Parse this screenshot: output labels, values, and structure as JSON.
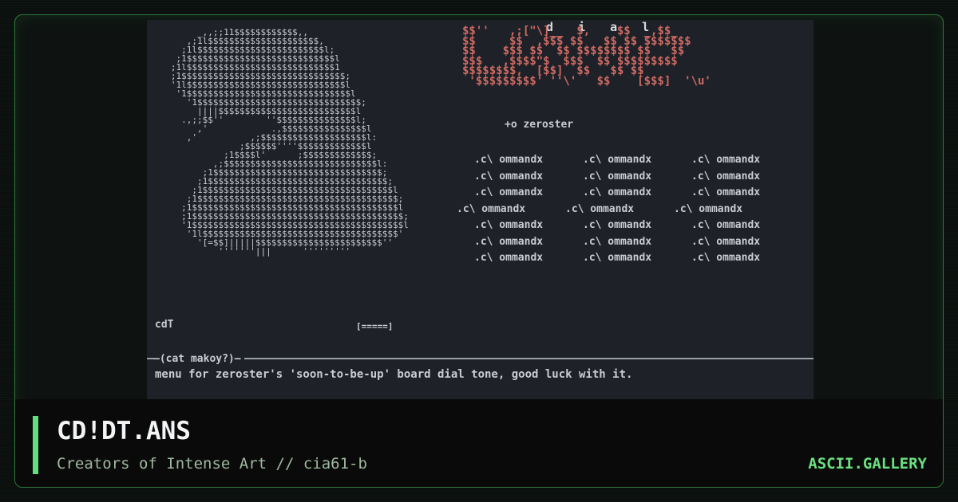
{
  "artwork": {
    "dial_letters": "d i a l",
    "logo_ascii": "$$''   ,;[\"\\]__  $,    $$  _,$$_\n$$     $$  ,$$$ $$   $$ $$ $$$$$$$\n$$    $$$ $$  $$ $$$$$$$$ $$   $$\n$$$   ,$$$$\"$  $$$  $$ $$$$$$$$$\n$$$$$$$$,  [$$]  $$   $$ $$\n '$$$$$$$$$' ''\\'   $$    [$$$]  '\\u'",
    "head_ascii": "        _,,;;11$$$$$$$$$$$$,,\n      ,;1l$$$$$$$$$$$$$$$$$$$$$,\n     ;1l$$$$$$$$$$$$$$$$$$$$$$$$l;\n    ;1$$$$$$$$$$$$$$$$$$$$$$$$$$$$l\n   ;1l$$$$$$$$$$$$$$$$$$$$$$$$$$$$1\n   ;1$$$$$$$$$$$$$$$$$$$$$$$$$$$$$$$;\n   '1l$$$$$$$$$$$$$$$$$$$$$$$$$$$$$$l\n    '1$$$$$$$$$$$$$$$$$$$$$$$$$$$$$$$l\n      '1$$$$$$$$$$$$$$$$$$$$$$$$$$$$$$$;\n        ||||$$$$$$$$$$$$$$$$$$$$$$$$$$l\n     .,;;$$''        ''$$$$$$$$$$$$$$$l;\n        ,'            .,$$$$$$$$$$$$$$$$l\n      ,'          ,;$$$$$$$$$$$$$$$$$$$$l:\n                ;$$$$$$''''$$$$$$$$$$$$$l\n             ;1$$$$l'      ;$$$$$$$$$$$$$;\n           ,;$$$$$$$$$$$$$$$$$$$$$$$$$$$$$l:\n         ;1$$$$$$$$$$$$$$$$$$$$$$$$$$$$$$$$;\n        ;1$$$$$$$$$$$$$$$$$$$$$$$$$$$$$$$$$$;\n       ;1$$$$$$$$$$$$$$$$$$$$$$$$$$$$$$$$$$$$l\n      ;1$$$$$$$$$$$$$$$$$$$$$$$$$$$$$$$$$$$$$$;\n     ;1$$$$$$$$$$$$$$$$$$$$$$$$$$$$$$$$$$$$$$$l\n     ;1$$$$$$$$$$$$$$$$$$$$$$$$$$$$$$$$$$$$$$$$;\n     '1$$$$$$$$$$$$$$$$$$$$$$$$$$$$$$$$$$$$$$$$l\n      '1l$$$$$$$$$$$$$$$$$$$$$$$$$$$$$$$$$$$$$'\n        '[=$$]|||||$$$$$$$$$$$$$$$$$$$$$$$$''\n            '''''''|||      '''''''''",
    "byline": "+o zeroster",
    "menu_rows": [
      [
        ".c\\ ommandx",
        ".c\\ ommandx",
        ".c\\ ommandx"
      ],
      [
        ".c\\ ommandx",
        ".c\\ ommandx",
        ".c\\ ommandx"
      ],
      [
        ".c\\ ommandx",
        ".c\\ ommandx",
        ".c\\ ommandx"
      ],
      [
        ".c\\ ommandx",
        ".c\\ ommandx",
        ".c\\ ommandx"
      ],
      [
        ".c\\ ommandx",
        ".c\\ ommandx",
        ".c\\ ommandx"
      ],
      [
        ".c\\ ommandx",
        ".c\\ ommandx",
        ".c\\ ommandx"
      ],
      [
        ".c\\ ommandx",
        ".c\\ ommandx",
        ".c\\ ommandx"
      ]
    ],
    "cdt_tag": "cdT",
    "sub_bar": "[=====]",
    "divider_label": "—(cat makoy?)—",
    "caption": "menu for zeroster's 'soon-to-be-up' board dial tone, good luck with it."
  },
  "footer": {
    "title": "CD!DT.ANS",
    "subtitle": "Creators of Intense Art // cia61-b",
    "brand": "ASCII.GALLERY"
  },
  "colors": {
    "accent": "#5fe07a",
    "logo_red": "#cf6a63",
    "border_green": "#2f7a3c"
  }
}
